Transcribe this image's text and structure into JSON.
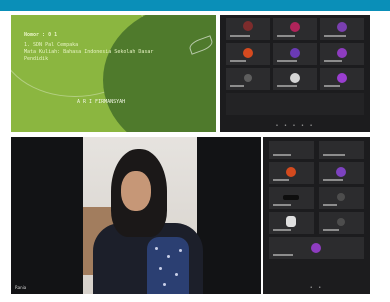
{
  "slide": {
    "title": "Nomor : 0 1",
    "subtitle_line1": "1. SDN Pal Cempaka",
    "subtitle_line2": "Mata Kuliah: Bahasa Indonesia Sekolah Dasar",
    "subtitle_line3": "Pendidik",
    "presenter": "A R I FIRMANSYAH"
  },
  "video": {
    "participant_label": "Rania"
  },
  "colors": {
    "top_bar": "#0a8fb8",
    "slide_light": "#8bb640",
    "slide_dark": "#4f7a2c",
    "grid_background": "#1c1c1e",
    "tile_background": "#2c2c2e"
  },
  "pager": {
    "grid1": "• • • • •",
    "grid2": "• •"
  }
}
